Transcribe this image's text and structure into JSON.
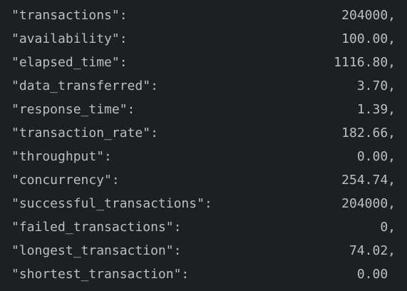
{
  "colors": {
    "background": "#1e1f22",
    "text": "#bcbec4"
  },
  "rows": [
    {
      "key": "\"transactions\":",
      "value": "204000,"
    },
    {
      "key": "\"availability\":",
      "value": "100.00,"
    },
    {
      "key": "\"elapsed_time\":",
      "value": "1116.80,"
    },
    {
      "key": "\"data_transferred\":",
      "value": "3.70,"
    },
    {
      "key": "\"response_time\":",
      "value": "1.39,"
    },
    {
      "key": "\"transaction_rate\":",
      "value": "182.66,"
    },
    {
      "key": "\"throughput\":",
      "value": "0.00,"
    },
    {
      "key": "\"concurrency\":",
      "value": "254.74,"
    },
    {
      "key": "\"successful_transactions\":",
      "value": "204000,"
    },
    {
      "key": "\"failed_transactions\":",
      "value": "0,"
    },
    {
      "key": "\"longest_transaction\":",
      "value": "74.02,"
    },
    {
      "key": "\"shortest_transaction\":",
      "value": "0.00 "
    }
  ]
}
